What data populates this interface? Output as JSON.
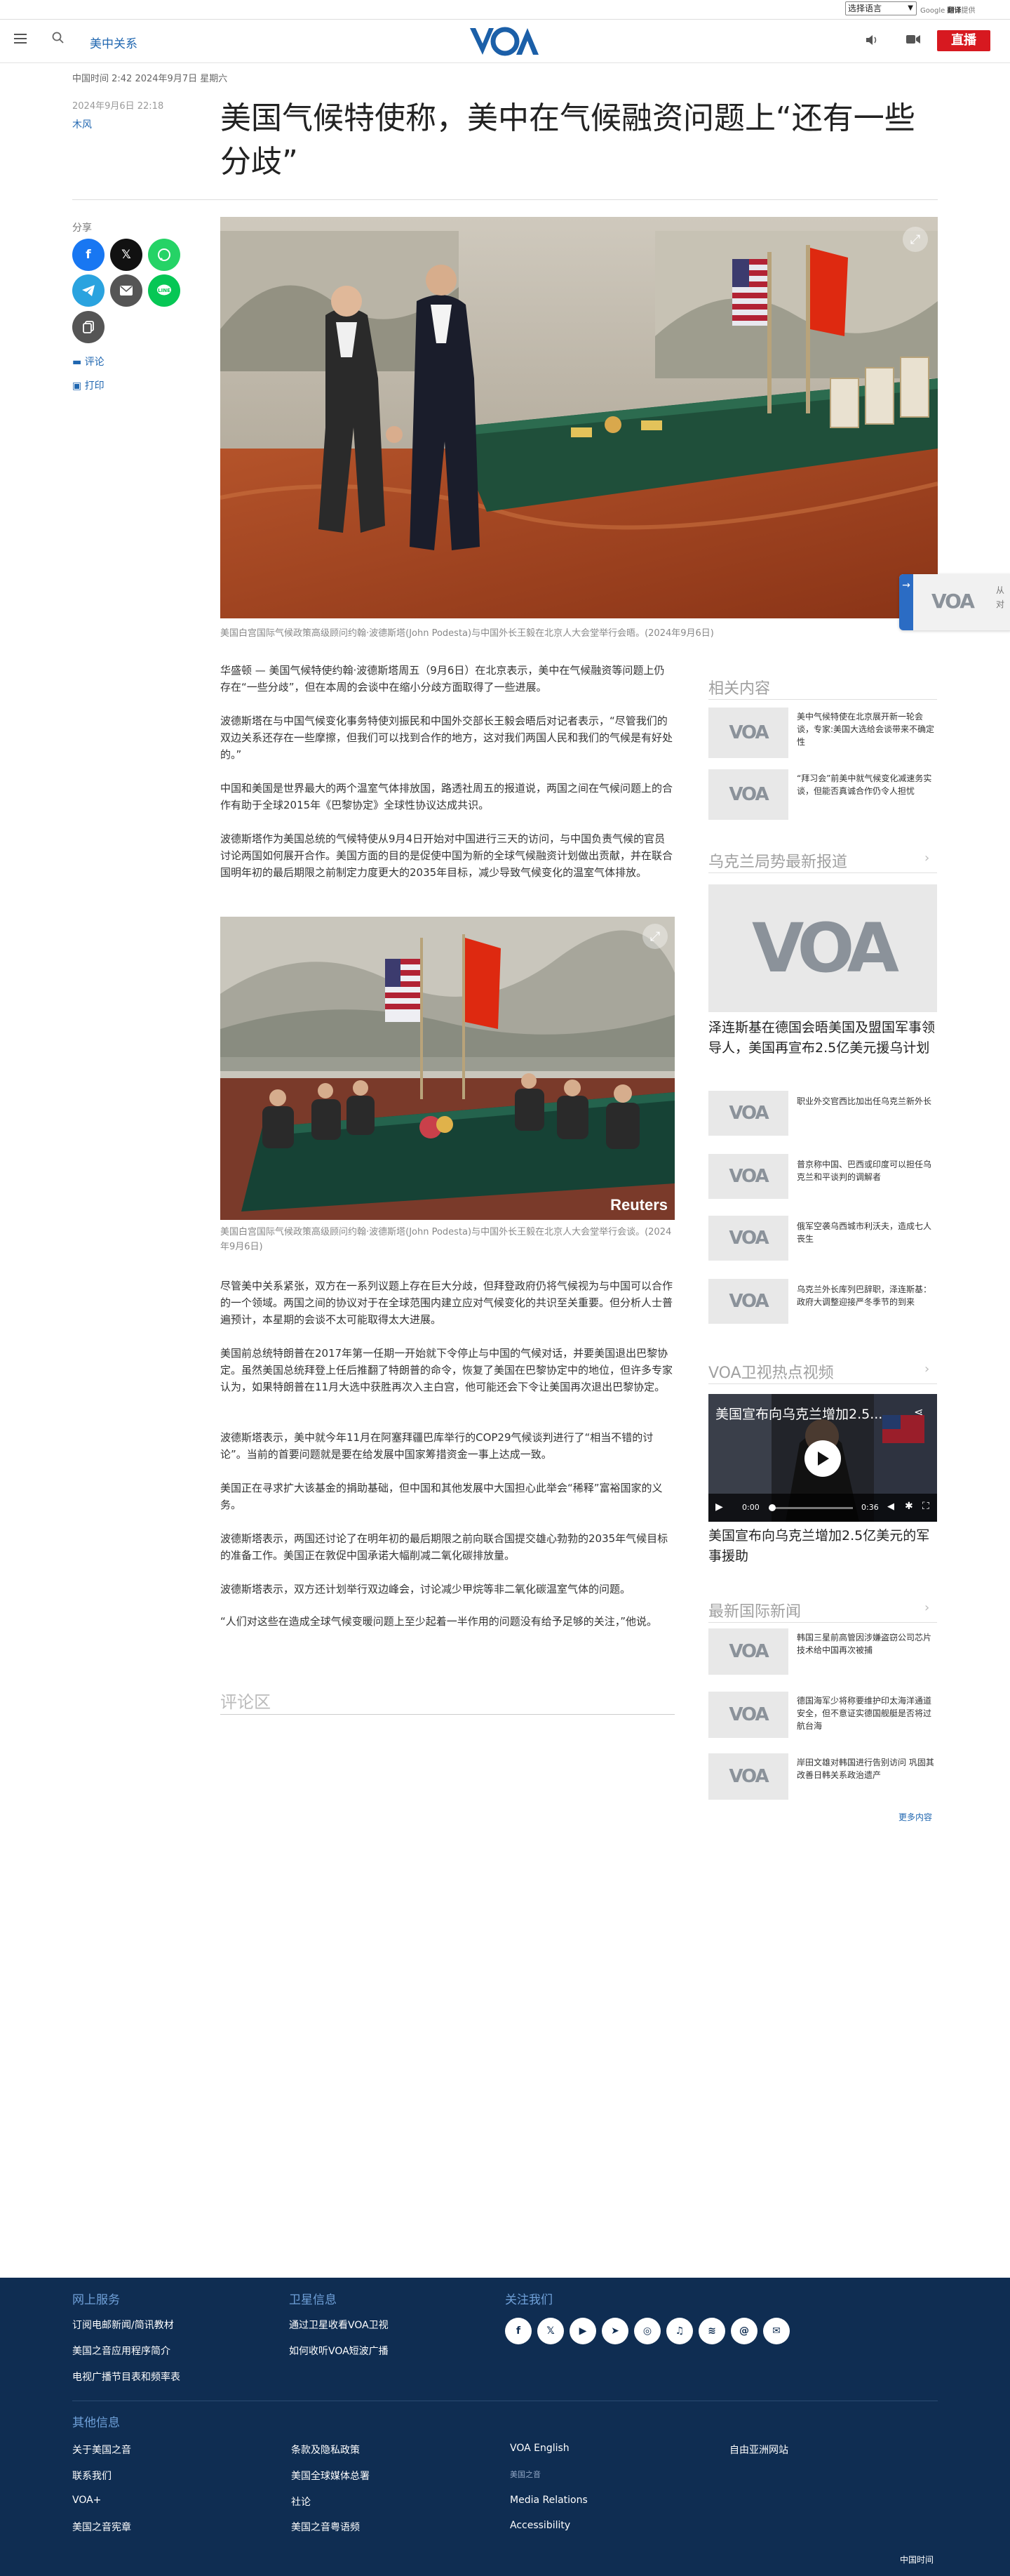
{
  "translate_bar": {
    "select_label": "选择语言",
    "powered": "Google",
    "translate": "翻译",
    "powered_prefix": "技术支持",
    "powered_suffix": "提供"
  },
  "header": {
    "section": "美中关系",
    "live_button": "直播",
    "logo_text": "VOA"
  },
  "article": {
    "meta_time": "中国时间 2:42 2024年9月7日 星期六",
    "pub_date": "2024年9月6日 22:18",
    "author": "木风",
    "headline": "美国气候特使称，美中在气候融资问题上“还有一些分歧”",
    "share_label": "分享",
    "comment_link": "评论",
    "print_link": "打印",
    "caption1": "美国白宫国际气候政策高级顾问约翰·波德斯塔(John Podesta)与中国外长王毅在北京人大会堂举行会晤。(2024年9月6日)",
    "paragraphs_a": [
      "华盛顿 — 美国气候特使约翰·波德斯塔周五（9月6日）在北京表示，美中在气候融资等问题上仍存在“一些分歧”，但在本周的会谈中在缩小分歧方面取得了一些进展。",
      "波德斯塔在与中国气候变化事务特使刘振民和中国外交部长王毅会晤后对记者表示，“尽管我们的双边关系还存在一些摩擦，但我们可以找到合作的地方，这对我们两国人民和我们的气候是有好处的。”",
      "中国和美国是世界最大的两个温室气体排放国，路透社周五的报道说，两国之间在气候问题上的合作有助于全球2015年《巴黎协定》全球性协议达成共识。",
      "波德斯塔作为美国总统的气候特使从9月4日开始对中国进行三天的访问，与中国负责气候的官员讨论两国如何展开合作。美国方面的目的是促使中国为新的全球气候融资计划做出贡献，并在联合国明年初的最后期限之前制定力度更大的2035年目标，减少导致气候变化的温室气体排放。"
    ],
    "caption2": "美国白宫国际气候政策高级顾问约翰·波德斯塔(John Podesta)与中国外长王毅在北京人大会堂举行会谈。(2024年9月6日)",
    "photo2_credit": "Reuters",
    "paragraphs_b": [
      "尽管美中关系紧张，双方在一系列议题上存在巨大分歧，但拜登政府仍将气候视为与中国可以合作的一个领域。两国之间的协议对于在全球范围内建立应对气候变化的共识至关重要。但分析人士普遍预计，本星期的会谈不太可能取得太大进展。",
      "美国前总统特朗普在2017年第一任期一开始就下令停止与中国的气候对话，并要美国退出巴黎协定。虽然美国总统拜登上任后推翻了特朗普的命令，恢复了美国在巴黎协定中的地位，但许多专家认为，如果特朗普在11月大选中获胜再次入主白宫，他可能还会下令让美国再次退出巴黎协定。",
      "波德斯塔表示，美中就今年11月在阿塞拜疆巴库举行的COP29气候谈判进行了“相当不错的讨论”。当前的首要问题就是要在给发展中国家筹措资金一事上达成一致。",
      "美国正在寻求扩大该基金的捐助基础，但中国和其他发展中大国担心此举会“稀释”富裕国家的义务。",
      "波德斯塔表示，两国还讨论了在明年初的最后期限之前向联合国提交雄心勃勃的2035年气候目标的准备工作。美国正在敦促中国承诺大幅削减二氧化碳排放量。",
      "波德斯塔表示，双方还计划举行双边峰会，讨论减少甲烷等非二氧化碳温室气体的问题。",
      "“人们对这些在造成全球气候变暖问题上至少起着一半作用的问题没有给予足够的关注，”他说。"
    ],
    "comments_title": "评论区"
  },
  "sidebar": {
    "related_title": "相关内容",
    "related": [
      "美中气候特使在北京展开新一轮会谈，专家:美国大选给会谈带来不确定性",
      "“拜习会”前美中就气候变化减速务实谈，但能否真诚合作仍令人担忧"
    ],
    "ukraine_title": "乌克兰局势最新报道",
    "ukraine_big": "泽连斯基在德国会晤美国及盟国军事领导人，美国再宣布2.5亿美元援乌计划",
    "ukraine_items": [
      "职业外交官西比加出任乌克兰新外长",
      "普京称中国、巴西或印度可以担任乌克兰和平谈判的调解者",
      "俄军空袭乌西城市利沃夫，造成七人丧生",
      "乌克兰外长库列巴辞职，泽连斯基：政府大调整迎接严冬季节的到来"
    ],
    "video_title": "VOA卫视热点视频",
    "video_overlay": "美国宣布向乌克兰增加2.5...",
    "video_time_current": "0:00",
    "video_time_total": "0:36",
    "video_caption": "美国宣布向乌克兰增加2.5亿美元的军事援助",
    "intl_title": "最新国际新闻",
    "intl_items": [
      "韩国三星前高管因涉嫌盗窃公司芯片技术给中国再次被捕",
      "德国海军少将称要维护印太海洋通道安全，但不意证实德国舰艇是否将过航台海",
      "岸田文雄对韩国进行告别访问 巩固其改善日韩关系政治遗产"
    ],
    "more_link": "更多内容"
  },
  "slide_banner": {
    "text_top": "从",
    "text_bottom": "对"
  },
  "footer": {
    "col1_title": "网上服务",
    "col1_links": [
      "订阅电邮新闻/简讯教材",
      "美国之音应用程序简介",
      "电视广播节目表和频率表"
    ],
    "col2_title": "卫星信息",
    "col2_links": [
      "通过卫星收看VOA卫视",
      "如何收听VOA短波广播"
    ],
    "col3_title": "关注我们",
    "socials": [
      "facebook-icon",
      "x-icon",
      "youtube-icon",
      "telegram-icon",
      "instagram-icon",
      "podcast-icon",
      "rss-icon",
      "threads-icon",
      "email-icon"
    ],
    "other_title": "其他信息",
    "other_links": [
      [
        "关于美国之音",
        "条款及隐私政策",
        "VOA English",
        "自由亚洲网站"
      ],
      [
        "联系我们",
        "美国全球媒体总署",
        "美国之音",
        ""
      ],
      [
        "VOA+",
        "社论",
        "Media Relations",
        ""
      ],
      [
        "美国之音宪章",
        "美国之音粤语频",
        "Accessibility",
        ""
      ]
    ],
    "bottom_time": "中国时间"
  },
  "colors": {
    "accent": "#1f66b0",
    "live": "#d71920",
    "footer_bg": "#0f2d52"
  }
}
